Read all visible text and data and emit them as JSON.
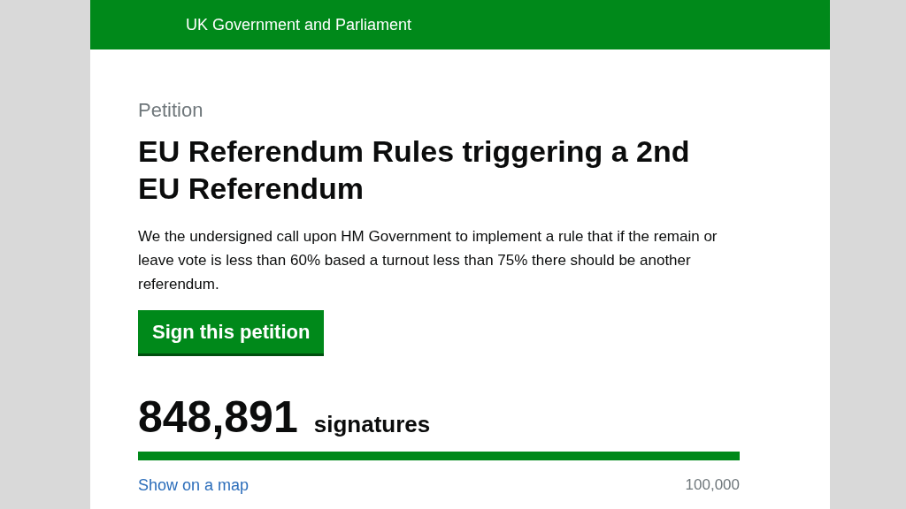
{
  "header": {
    "title": "UK Government and Parliament"
  },
  "petition": {
    "label": "Petition",
    "title": "EU Referendum Rules triggering a 2nd EU Referendum",
    "text": "We the undersigned call upon HM Government to implement a rule that if the remain or leave vote is less than 60% based a turnout less than 75% there should be another referendum.",
    "sign_button": "Sign this petition"
  },
  "signatures": {
    "count": "848,891",
    "unit": "signatures",
    "level": 1,
    "map_link": "Show on a map",
    "target": "100,000"
  }
}
